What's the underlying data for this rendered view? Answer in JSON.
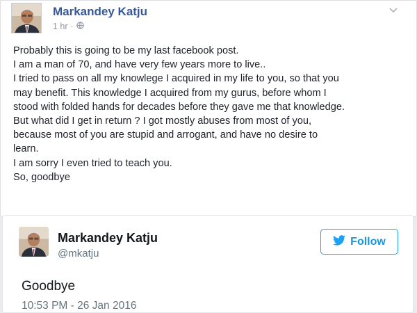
{
  "facebook_post": {
    "author_name": "Markandey Katju",
    "time": "1 hr",
    "separator": "·",
    "privacy_icon": "globe-icon",
    "body_lines": [
      "Probably this is going to be my last facebook post.",
      "I am a man of 70, and have very few years more to live..",
      "I tried to pass on all my knowlege I acquired in my life to you, so that you",
      "may benefit. This knowledge I acquired from my gurus, before whom I",
      "stood with folded hands for decades before they gave me that knowledge.",
      "But what did I get in return ? I got mostly abuses from most of you,",
      "because most of you are stupid and arrogant, and have no desire to",
      "learn.",
      "I am sorry I even tried to teach you.",
      "So, goodbye"
    ],
    "menu_icon": "chevron-down-icon",
    "colors": {
      "name": "#365899",
      "meta": "#90949c",
      "text": "#1d2129"
    }
  },
  "tweet": {
    "author_name": "Markandey Katju",
    "handle": "@mkatju",
    "follow_label": "Follow",
    "follow_icon": "twitter-bird-icon",
    "text": "Goodbye",
    "timestamp": "10:53 PM - 26 Jan 2016",
    "colors": {
      "accent": "#1da1f2",
      "handle": "#66757f",
      "text": "#14171a"
    }
  }
}
